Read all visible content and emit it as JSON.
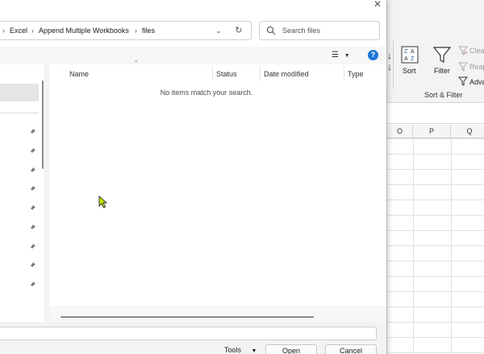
{
  "dialog": {
    "breadcrumb": [
      "Excel",
      "Append Multiple Workbooks",
      "files"
    ],
    "search_placeholder": "Search files",
    "columns": [
      "Name",
      "Status",
      "Date modified",
      "Type"
    ],
    "empty_message": "No items match your search.",
    "tools_label": "Tools",
    "open_label": "Open",
    "cancel_label": "Cancel",
    "nav_pinned_count": 9
  },
  "excel": {
    "sort_label": "Sort",
    "filter_label": "Filter",
    "clear_label": "Clea",
    "reapply_label": "Reap",
    "advanced_label": "Adva",
    "group_label": "Sort & Filter",
    "columns": [
      "O",
      "P",
      "Q"
    ]
  },
  "colors": {
    "accent": "#1f74d6",
    "cursor": "#c8e600",
    "ribbon_bg": "#f3f3f3",
    "selection": "#e5e5e5"
  }
}
